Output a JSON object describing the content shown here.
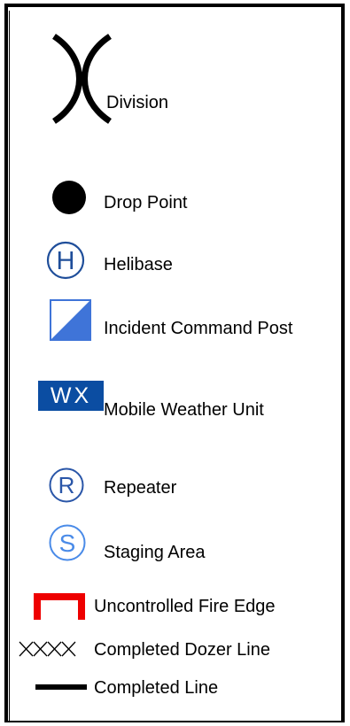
{
  "legend": {
    "items": [
      {
        "key": "division",
        "label": "Division",
        "icon": "division-icon"
      },
      {
        "key": "drop_point",
        "label": "Drop Point",
        "icon": "drop-point-icon"
      },
      {
        "key": "helibase",
        "label": "Helibase",
        "icon": "helibase-icon",
        "glyph": "H"
      },
      {
        "key": "icp",
        "label": "Incident Command Post",
        "icon": "incident-command-post-icon"
      },
      {
        "key": "mwu",
        "label": "Mobile Weather Unit",
        "icon": "mobile-weather-unit-icon",
        "glyph": "WX"
      },
      {
        "key": "repeater",
        "label": "Repeater",
        "icon": "repeater-icon",
        "glyph": "R"
      },
      {
        "key": "staging",
        "label": "Staging Area",
        "icon": "staging-area-icon",
        "glyph": "S"
      },
      {
        "key": "fire_edge",
        "label": "Uncontrolled Fire Edge",
        "icon": "uncontrolled-fire-edge-icon"
      },
      {
        "key": "dozer",
        "label": "Completed Dozer Line",
        "icon": "completed-dozer-line-icon"
      },
      {
        "key": "line",
        "label": "Completed Line",
        "icon": "completed-line-icon"
      }
    ]
  },
  "colors": {
    "helibase": "#1f4e9a",
    "icp": "#3f74d8",
    "mwu_bg": "#0b4da2",
    "repeater": "#2a56a8",
    "staging": "#4a8be8",
    "fire_edge": "#ee0000",
    "black": "#000000"
  }
}
